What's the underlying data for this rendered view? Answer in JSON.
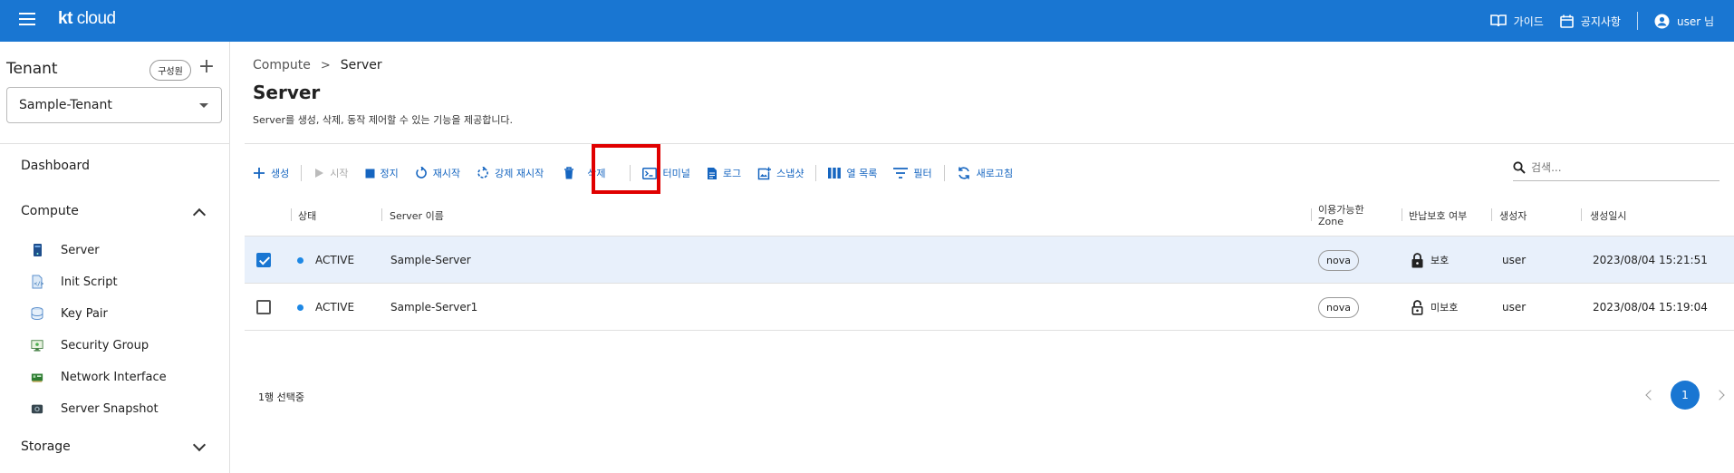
{
  "topbar": {
    "logo_kt": "kt",
    "logo_cloud": "cloud",
    "guide_label": "가이드",
    "notice_label": "공지사항",
    "user_label": "user 님"
  },
  "sidebar": {
    "tenant_title": "Tenant",
    "member_chip": "구성원",
    "tenant_selected": "Sample-Tenant",
    "dashboard": "Dashboard",
    "compute_label": "Compute",
    "storage_label": "Storage",
    "items": [
      {
        "label": "Server",
        "icon": "server-icon"
      },
      {
        "label": "Init Script",
        "icon": "script-icon"
      },
      {
        "label": "Key Pair",
        "icon": "key-pair-icon"
      },
      {
        "label": "Security Group",
        "icon": "security-group-icon"
      },
      {
        "label": "Network Interface",
        "icon": "network-interface-icon"
      },
      {
        "label": "Server Snapshot",
        "icon": "snapshot-icon"
      }
    ]
  },
  "main": {
    "breadcrumb": [
      "Compute",
      "Server"
    ],
    "title": "Server",
    "description": "Server를 생성, 삭제, 동작 제어할 수 있는 기능을 제공합니다.",
    "toolbar": {
      "create": "생성",
      "start": "시작",
      "stop": "정지",
      "restart": "재시작",
      "force_restart": "강제 재시작",
      "delete": "삭제",
      "terminal": "터미널",
      "log": "로그",
      "snapshot": "스냅샷",
      "columns": "열 목록",
      "filter": "필터",
      "refresh": "새로고침"
    },
    "search_placeholder": "검색..."
  },
  "table": {
    "headers": {
      "status": "상태",
      "name": "Server 이름",
      "zone_line1": "이용가능한",
      "zone_line2": "Zone",
      "protect": "반납보호 여부",
      "creator": "생성자",
      "created": "생성일시"
    },
    "rows": [
      {
        "status": "ACTIVE",
        "name": "Sample-Server",
        "zone": "nova",
        "protect": "보호",
        "creator": "user",
        "created": "2023/08/04 15:21:51",
        "checked": true
      },
      {
        "status": "ACTIVE",
        "name": "Sample-Server1",
        "zone": "nova",
        "protect": "미보호",
        "creator": "user",
        "created": "2023/08/04 15:19:04",
        "checked": false
      }
    ]
  },
  "footer": {
    "selected_count": "1행 선택중",
    "page": "1"
  },
  "colors": {
    "primary": "#1976d2",
    "highlight_border": "#e00000",
    "selected_row": "#e8f0fb"
  }
}
